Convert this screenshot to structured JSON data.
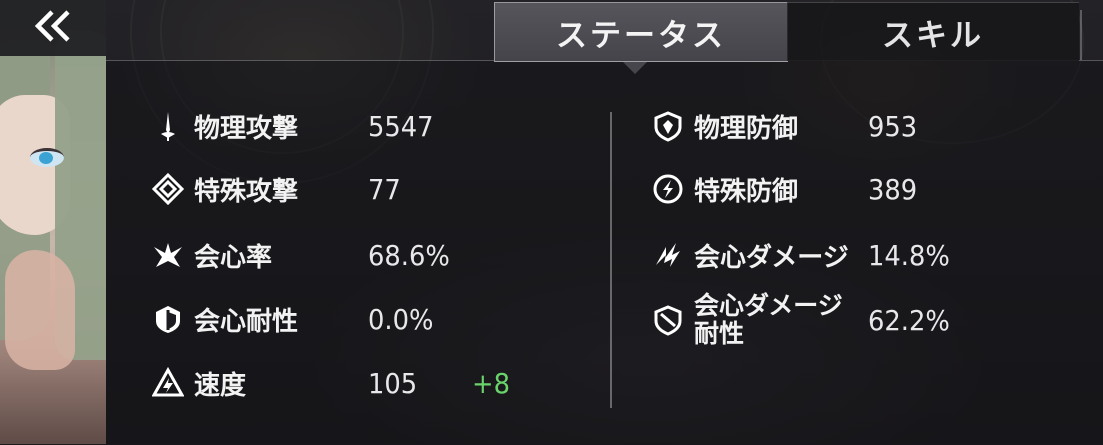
{
  "nav": {
    "back_icon": "double-chevron-left-icon"
  },
  "tabs": [
    {
      "label": "ステータス",
      "active": true
    },
    {
      "label": "スキル",
      "active": false
    }
  ],
  "stats_left": [
    {
      "icon": "sword-icon",
      "label": "物理攻撃",
      "value": "5547"
    },
    {
      "icon": "diamond-icon",
      "label": "特殊攻撃",
      "value": "77"
    },
    {
      "icon": "crit-rate-icon",
      "label": "会心率",
      "value": "68.6%"
    },
    {
      "icon": "crit-resist-icon",
      "label": "会心耐性",
      "value": "0.0%"
    },
    {
      "icon": "speed-icon",
      "label": "速度",
      "value": "105",
      "bonus": "+8"
    }
  ],
  "stats_right": [
    {
      "icon": "shield-icon",
      "label": "物理防御",
      "value": "953"
    },
    {
      "icon": "special-defense-icon",
      "label": "特殊防御",
      "value": "389"
    },
    {
      "icon": "crit-damage-icon",
      "label": "会心ダメージ",
      "value": "14.8%"
    },
    {
      "icon": "crit-damage-resist-icon",
      "label": "会心ダメージ耐性",
      "label_line1": "会心ダメージ",
      "label_line2": "耐性",
      "value": "62.2%"
    }
  ],
  "colors": {
    "bonus": "#6bd36b",
    "text": "#e9e9ea",
    "active_tab": "#4d4d53"
  }
}
